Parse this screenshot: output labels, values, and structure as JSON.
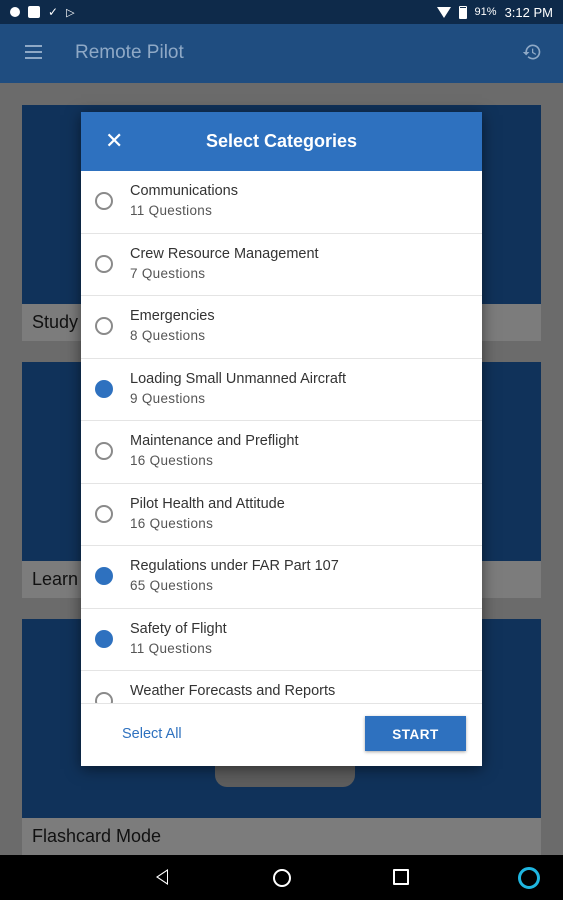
{
  "status_bar": {
    "battery": "91%",
    "time": "3:12 PM",
    "icons": [
      "location-icon",
      "image-icon",
      "check-icon",
      "play-store-icon",
      "wifi-icon",
      "battery-icon"
    ]
  },
  "app_bar": {
    "title": "Remote Pilot",
    "menu_icon": "hamburger-menu-icon",
    "history_icon": "history-icon"
  },
  "background_cards": [
    {
      "label": "Study"
    },
    {
      "label": "Learn"
    },
    {
      "label": "Flashcard Mode"
    }
  ],
  "dialog": {
    "title": "Select Categories",
    "close_icon": "close-icon",
    "categories": [
      {
        "name": "Communications",
        "count": "11 Questions",
        "selected": false
      },
      {
        "name": "Crew Resource Management",
        "count": "7 Questions",
        "selected": false
      },
      {
        "name": "Emergencies",
        "count": "8 Questions",
        "selected": false
      },
      {
        "name": "Loading Small Unmanned Aircraft",
        "count": "9 Questions",
        "selected": true
      },
      {
        "name": "Maintenance and Preflight",
        "count": "16 Questions",
        "selected": false
      },
      {
        "name": "Pilot Health and Attitude",
        "count": "16 Questions",
        "selected": false
      },
      {
        "name": "Regulations under FAR Part 107",
        "count": "65 Questions",
        "selected": true
      },
      {
        "name": "Safety of Flight",
        "count": "11 Questions",
        "selected": true
      },
      {
        "name": "Weather Forecasts and Reports",
        "count": "",
        "selected": false
      }
    ],
    "select_all_label": "Select All",
    "start_label": "START"
  },
  "colors": {
    "accent": "#2e71bf",
    "app_bar": "#1f4d80",
    "status_bar": "#0e2a4a"
  }
}
